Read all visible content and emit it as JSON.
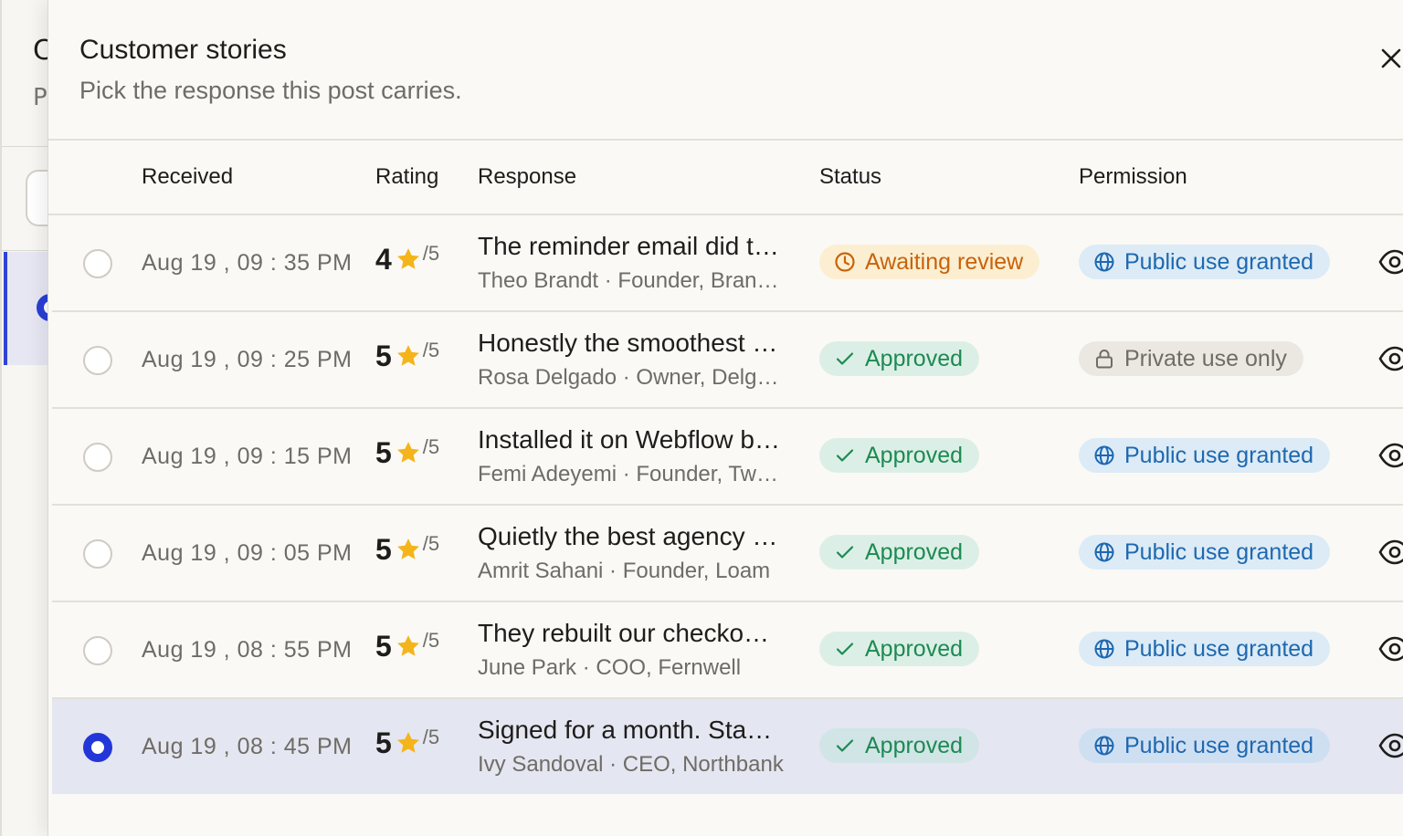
{
  "background": {
    "title_initial": "C",
    "subtitle_initial": "P"
  },
  "modal": {
    "title": "Customer stories",
    "subtitle": "Pick the response this post carries."
  },
  "table": {
    "headers": {
      "received": "Received",
      "rating": "Rating",
      "response": "Response",
      "status": "Status",
      "permission": "Permission"
    },
    "rating_suffix": "/5",
    "rows": [
      {
        "received": "Aug 19 , 09 : 35 PM",
        "rating": "4",
        "response": "The reminder email did t…",
        "author": "Theo Brandt · Founder, Bran…",
        "status": "Awaiting review",
        "status_kind": "awaiting",
        "permission": "Public use granted",
        "permission_kind": "public",
        "selected": false
      },
      {
        "received": "Aug 19 , 09 : 25 PM",
        "rating": "5",
        "response": "Honestly the smoothest …",
        "author": "Rosa Delgado · Owner, Delga…",
        "status": "Approved",
        "status_kind": "approved",
        "permission": "Private use only",
        "permission_kind": "private",
        "selected": false
      },
      {
        "received": "Aug 19 , 09 : 15 PM",
        "rating": "5",
        "response": "Installed it on Webflow b…",
        "author": "Femi Adeyemi · Founder, Tw…",
        "status": "Approved",
        "status_kind": "approved",
        "permission": "Public use granted",
        "permission_kind": "public",
        "selected": false
      },
      {
        "received": "Aug 19 , 09 : 05 PM",
        "rating": "5",
        "response": "Quietly the best agency …",
        "author": "Amrit Sahani · Founder, Loam",
        "status": "Approved",
        "status_kind": "approved",
        "permission": "Public use granted",
        "permission_kind": "public",
        "selected": false
      },
      {
        "received": "Aug 19 , 08 : 55 PM",
        "rating": "5",
        "response": "They rebuilt our checko…",
        "author": "June Park · COO, Fernwell",
        "status": "Approved",
        "status_kind": "approved",
        "permission": "Public use granted",
        "permission_kind": "public",
        "selected": false
      },
      {
        "received": "Aug 19 , 08 : 45 PM",
        "rating": "5",
        "response": "Signed for a month. Sta…",
        "author": "Ivy Sandoval · CEO, Northbank",
        "status": "Approved",
        "status_kind": "approved",
        "permission": "Public use granted",
        "permission_kind": "public",
        "selected": true
      }
    ]
  },
  "icons": {
    "close": "close-icon",
    "star": "star-icon",
    "clock": "clock-icon",
    "check": "check-icon",
    "globe": "globe-icon",
    "lock": "lock-icon",
    "eye": "eye-icon"
  },
  "colors": {
    "accent": "#2337d8",
    "star": "#f4b41a",
    "awaiting": "#c8620b",
    "approved": "#1c8a52",
    "public": "#1e68b0",
    "private": "#6f6c66"
  }
}
